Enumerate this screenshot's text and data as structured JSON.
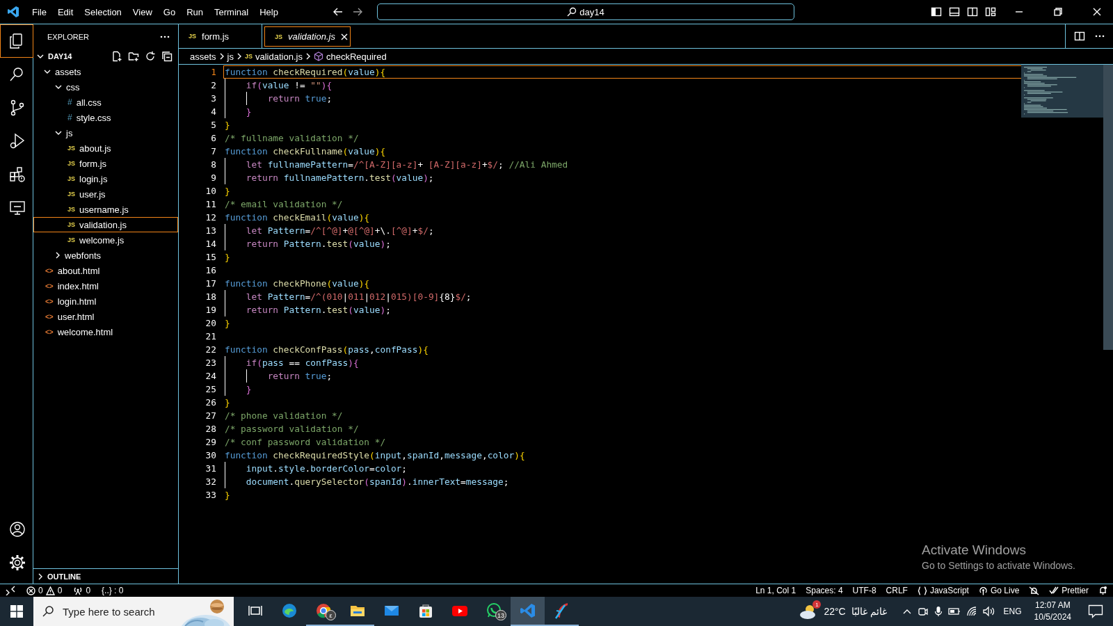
{
  "title_bar": {
    "menu": [
      "File",
      "Edit",
      "Selection",
      "View",
      "Go",
      "Run",
      "Terminal",
      "Help"
    ],
    "search": "day14"
  },
  "activity_bar": {
    "top": [
      {
        "kind": "explorer",
        "selected": true
      },
      {
        "kind": "search",
        "selected": false
      },
      {
        "kind": "source-control",
        "selected": false
      },
      {
        "kind": "run",
        "selected": false
      },
      {
        "kind": "extensions",
        "selected": false
      },
      {
        "kind": "remote",
        "selected": false
      }
    ],
    "bottom": [
      {
        "kind": "account"
      },
      {
        "kind": "settings"
      }
    ]
  },
  "explorer": {
    "title": "EXPLORER",
    "root": {
      "label": "DAY14",
      "expanded": true,
      "children": [
        {
          "kind": "folder",
          "label": "assets",
          "expanded": true,
          "selected": false,
          "children": [
            {
              "kind": "folder",
              "label": "css",
              "expanded": true,
              "selected": false,
              "children": [
                {
                  "kind": "file",
                  "icon": "#",
                  "label": "all.css",
                  "selected": false
                },
                {
                  "kind": "file",
                  "icon": "#",
                  "label": "style.css",
                  "selected": false
                }
              ]
            },
            {
              "kind": "folder",
              "label": "js",
              "expanded": true,
              "selected": false,
              "children": [
                {
                  "kind": "file",
                  "icon": "JS",
                  "label": "about.js",
                  "selected": false
                },
                {
                  "kind": "file",
                  "icon": "JS",
                  "label": "form.js",
                  "selected": false
                },
                {
                  "kind": "file",
                  "icon": "JS",
                  "label": "login.js",
                  "selected": false
                },
                {
                  "kind": "file",
                  "icon": "JS",
                  "label": "user.js",
                  "selected": false
                },
                {
                  "kind": "file",
                  "icon": "JS",
                  "label": "username.js",
                  "selected": false
                },
                {
                  "kind": "file",
                  "icon": "JS",
                  "label": "validation.js",
                  "selected": true
                },
                {
                  "kind": "file",
                  "icon": "JS",
                  "label": "welcome.js",
                  "selected": false
                }
              ]
            },
            {
              "kind": "folder",
              "label": "webfonts",
              "expanded": false,
              "selected": false
            }
          ]
        },
        {
          "kind": "file",
          "icon": "<>",
          "label": "about.html",
          "selected": false
        },
        {
          "kind": "file",
          "icon": "<>",
          "label": "index.html",
          "selected": false
        },
        {
          "kind": "file",
          "icon": "<>",
          "label": "login.html",
          "selected": false
        },
        {
          "kind": "file",
          "icon": "<>",
          "label": "user.html",
          "selected": false
        },
        {
          "kind": "file",
          "icon": "<>",
          "label": "welcome.html",
          "selected": false
        }
      ]
    },
    "outline": {
      "label": "OUTLINE",
      "expanded": false
    }
  },
  "tabs": [
    {
      "icon": "JS",
      "label": "form.js",
      "selected": false
    },
    {
      "icon": "JS",
      "label": "validation.js",
      "selected": true
    }
  ],
  "breadcrumb": [
    {
      "kind": "folder",
      "label": "assets"
    },
    {
      "kind": "folder",
      "label": "js"
    },
    {
      "kind": "file",
      "icon": "JS",
      "label": "validation.js"
    },
    {
      "kind": "symbol",
      "label": "checkRequired"
    }
  ],
  "code": [
    {
      "number": "1",
      "current": true,
      "text": "function checkRequired(value){"
    },
    {
      "number": "2",
      "current": false,
      "text": "    if(value != \"\"){"
    },
    {
      "number": "3",
      "current": false,
      "text": "        return true;"
    },
    {
      "number": "4",
      "current": false,
      "text": "    }"
    },
    {
      "number": "5",
      "current": false,
      "text": "}"
    },
    {
      "number": "6",
      "current": false,
      "text": "/* fullname validation */"
    },
    {
      "number": "7",
      "current": false,
      "text": "function checkFullname(value){"
    },
    {
      "number": "8",
      "current": false,
      "text": "    let fullnamePattern=/^[A-Z][a-z]+ [A-Z][a-z]+$/; //Ali Ahmed"
    },
    {
      "number": "9",
      "current": false,
      "text": "    return fullnamePattern.test(value);"
    },
    {
      "number": "10",
      "current": false,
      "text": "}"
    },
    {
      "number": "11",
      "current": false,
      "text": "/* email validation */"
    },
    {
      "number": "12",
      "current": false,
      "text": "function checkEmail(value){"
    },
    {
      "number": "13",
      "current": false,
      "text": "    let Pattern=/^[^@]+@[^@]+\\.[^@]+$/;"
    },
    {
      "number": "14",
      "current": false,
      "text": "    return Pattern.test(value);"
    },
    {
      "number": "15",
      "current": false,
      "text": "}"
    },
    {
      "number": "16",
      "current": false
    },
    {
      "number": "17",
      "current": false,
      "text": "function checkPhone(value){"
    },
    {
      "number": "18",
      "current": false,
      "text": "    let Pattern=/^(010|011|012|015)[0-9]{8}$/;"
    },
    {
      "number": "19",
      "current": false,
      "text": "    return Pattern.test(value);"
    },
    {
      "number": "20",
      "current": false,
      "text": "}"
    },
    {
      "number": "21",
      "current": false
    },
    {
      "number": "22",
      "current": false,
      "text": "function checkConfPass(pass,confPass){"
    },
    {
      "number": "23",
      "current": false,
      "text": "    if(pass == confPass){"
    },
    {
      "number": "24",
      "current": false,
      "text": "        return true;"
    },
    {
      "number": "25",
      "current": false,
      "text": "    }"
    },
    {
      "number": "26",
      "current": false,
      "text": "}"
    },
    {
      "number": "27",
      "current": false,
      "text": "/* phone validation */"
    },
    {
      "number": "28",
      "current": false,
      "text": "/* password validation */"
    },
    {
      "number": "29",
      "current": false,
      "text": "/* conf password validation */"
    },
    {
      "number": "30",
      "current": false,
      "text": "function checkRequiredStyle(input,spanId,message,color){"
    },
    {
      "number": "31",
      "current": false,
      "text": "    input.style.borderColor=color;"
    },
    {
      "number": "32",
      "current": false,
      "text": "    document.querySelector(spanId).innerText=message;"
    },
    {
      "number": "33",
      "current": false,
      "text": "}"
    }
  ],
  "os_notice": {
    "title": "Activate Windows",
    "subtitle": "Go to Settings to activate Windows."
  },
  "status_bar": {
    "left": [
      {
        "kind": "remote"
      },
      {
        "kind": "problems",
        "errors": "0",
        "warnings": "0"
      },
      {
        "kind": "ports",
        "label": "0"
      },
      {
        "kind": "text",
        "label": "{..} : 0"
      }
    ],
    "right": [
      {
        "kind": "text",
        "label": "Ln 1, Col 1"
      },
      {
        "kind": "text",
        "label": "Spaces: 4"
      },
      {
        "kind": "text",
        "label": "UTF-8"
      },
      {
        "kind": "text",
        "label": "CRLF"
      },
      {
        "kind": "language",
        "label": "JavaScript"
      },
      {
        "kind": "golive",
        "label": "Go Live"
      },
      {
        "kind": "no-bell"
      },
      {
        "kind": "prettier",
        "label": "Prettier"
      },
      {
        "kind": "bell"
      }
    ]
  },
  "taskbar": {
    "search": {
      "placeholder": "Type here to search"
    },
    "apps": [
      {
        "kind": "taskview",
        "running": false
      },
      {
        "kind": "edge",
        "running": false
      },
      {
        "kind": "chrome",
        "running": true,
        "badge": "ε"
      },
      {
        "kind": "files",
        "running": true
      },
      {
        "kind": "mail",
        "running": false
      },
      {
        "kind": "store",
        "running": false
      },
      {
        "kind": "video",
        "running": false
      },
      {
        "kind": "chat",
        "running": false,
        "badge": "13"
      },
      {
        "kind": "editor",
        "running": true,
        "active": true
      },
      {
        "kind": "app",
        "running": true
      }
    ],
    "weather": {
      "badge": "1",
      "temp": "22°C",
      "text": "غائم غالبًا"
    },
    "language": "ENG",
    "time": "12:07 AM",
    "date": "10/5/2024"
  }
}
